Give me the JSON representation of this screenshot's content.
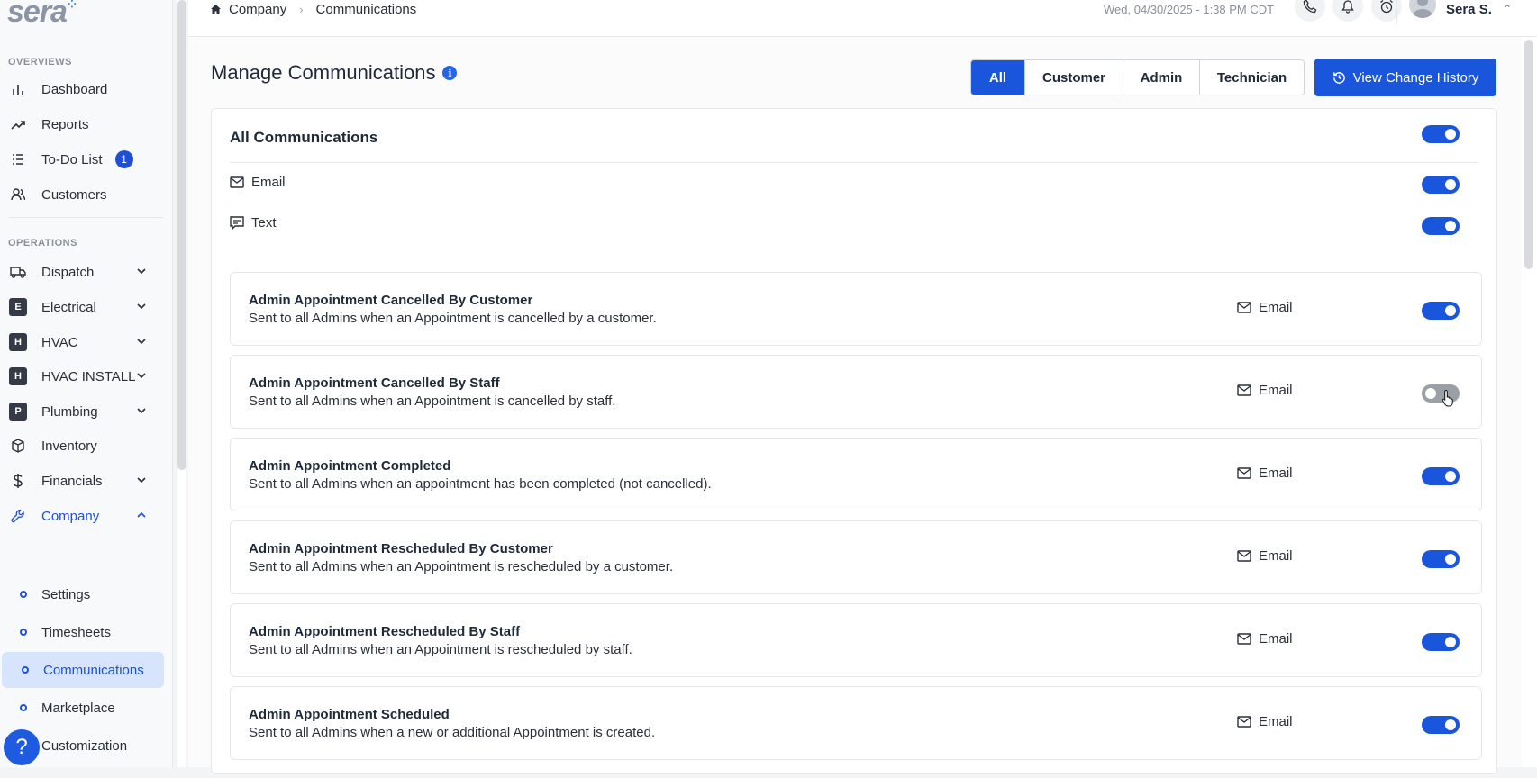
{
  "logo": {
    "text": "sera",
    "dots": "⁘"
  },
  "sidebar": {
    "overviews_label": "OVERVIEWS",
    "operations_label": "OPERATIONS",
    "overviews": [
      {
        "label": "Dashboard",
        "icon": "bar-chart-icon"
      },
      {
        "label": "Reports",
        "icon": "trend-icon"
      },
      {
        "label": "To-Do List",
        "icon": "list-icon",
        "badge": "1"
      },
      {
        "label": "Customers",
        "icon": "users-icon"
      }
    ],
    "operations": [
      {
        "label": "Dispatch",
        "icon": "truck-icon"
      },
      {
        "label": "Electrical",
        "letter": "E"
      },
      {
        "label": "HVAC",
        "letter": "H"
      },
      {
        "label": "HVAC INSTALL",
        "letter": "H"
      },
      {
        "label": "Plumbing",
        "letter": "P"
      },
      {
        "label": "Inventory",
        "icon": "box-icon"
      },
      {
        "label": "Financials",
        "icon": "dollar-icon"
      },
      {
        "label": "Company",
        "icon": "wrench-icon"
      }
    ],
    "company_sub": [
      {
        "label": "Settings"
      },
      {
        "label": "Timesheets"
      },
      {
        "label": "Communications",
        "active": true
      },
      {
        "label": "Marketplace"
      },
      {
        "label": "Customization"
      }
    ],
    "help": "?"
  },
  "topbar": {
    "breadcrumb": [
      "Company",
      "Communications"
    ],
    "datetime": "Wed, 04/30/2025 - 1:38 PM CDT",
    "user": "Sera S."
  },
  "page": {
    "title": "Manage Communications",
    "info": "i",
    "filters": [
      "All",
      "Customer",
      "Admin",
      "Technician"
    ],
    "active_filter": "All",
    "history_button": "View Change History"
  },
  "all_comms": {
    "title": "All Communications",
    "channels": [
      {
        "label": "Email",
        "on": true
      },
      {
        "label": "Text",
        "on": true
      }
    ],
    "on": true
  },
  "rows": [
    {
      "title": "Admin Appointment Cancelled By Customer",
      "desc": "Sent to all Admins when an Appointment is cancelled by a customer.",
      "channel": "Email",
      "on": true
    },
    {
      "title": "Admin Appointment Cancelled By Staff",
      "desc": "Sent to all Admins when an Appointment is cancelled by staff.",
      "channel": "Email",
      "on": false
    },
    {
      "title": "Admin Appointment Completed",
      "desc": "Sent to all Admins when an appointment has been completed (not cancelled).",
      "channel": "Email",
      "on": true
    },
    {
      "title": "Admin Appointment Rescheduled By Customer",
      "desc": "Sent to all Admins when an Appointment is rescheduled by a customer.",
      "channel": "Email",
      "on": true
    },
    {
      "title": "Admin Appointment Rescheduled By Staff",
      "desc": "Sent to all Admins when an Appointment is rescheduled by staff.",
      "channel": "Email",
      "on": true
    },
    {
      "title": "Admin Appointment Scheduled",
      "desc": "Sent to all Admins when a new or additional Appointment is created.",
      "channel": "Email",
      "on": true
    }
  ],
  "colors": {
    "accent": "#1a56db",
    "toggle_off": "#9aa0a6",
    "active_bg": "#d6e5fb"
  }
}
